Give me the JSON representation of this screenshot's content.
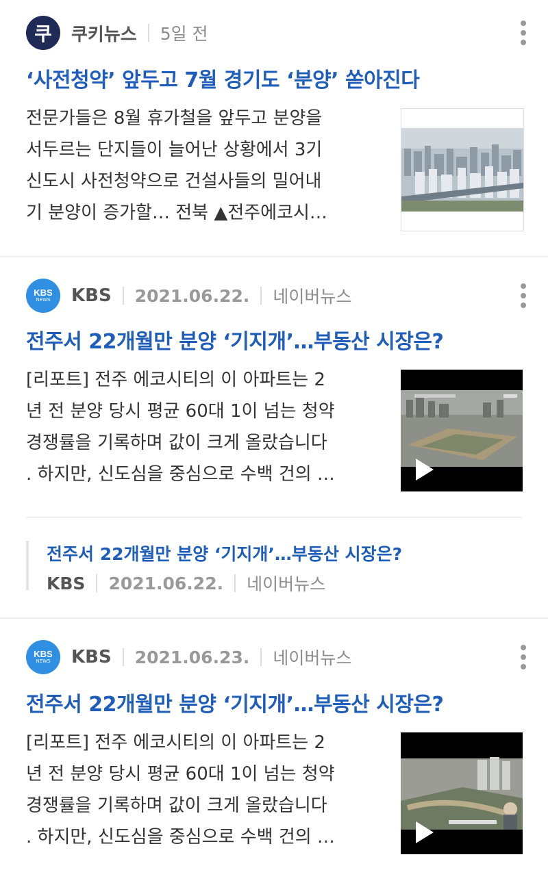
{
  "articles": [
    {
      "source": "쿠키뉴스",
      "time": "5일 전",
      "logo_char": "쿠",
      "headline": "‘사전청약’ 앞두고 7월 경기도 ‘분양’ 쏟아진다",
      "summary_lines": [
        "전문가들은 8월 휴가철을 앞두고 분양을",
        "서두르는 단지들이 늘어난 상황에서 3기",
        "신도시 사전청약으로 건설사들의 밀어내",
        "기 분양이 증가할… 전북 ▲전주에코시…"
      ],
      "thumbnail": "apartment-city-photo"
    },
    {
      "source": "KBS",
      "logo_line1": "KBS",
      "logo_line2": "NEWS",
      "date": "2021.06.22.",
      "portal": "네이버뉴스",
      "headline": "전주서 22개월만 분양 ‘기지개’…부동산 시장은?",
      "summary_lines": [
        "[리포트] 전주 에코시티의 이 아파트는 2",
        "년 전 분양 당시 평균 60대 1이 넘는 청약",
        "경쟁률을 기록하며 값이 크게 올랐습니다",
        ". 하지만, 신도심을 중심으로 수백 건의 …"
      ],
      "thumbnail": "video-thumbnail",
      "related": {
        "title": "전주서 22개월만 분양 ‘기지개’…부동산 시장은?",
        "source": "KBS",
        "date": "2021.06.22.",
        "portal": "네이버뉴스"
      }
    },
    {
      "source": "KBS",
      "logo_line1": "KBS",
      "logo_line2": "NEWS",
      "date": "2021.06.23.",
      "portal": "네이버뉴스",
      "headline": "전주서 22개월만 분양 ‘기지개’…부동산 시장은?",
      "summary_lines": [
        "[리포트] 전주 에코시티의 이 아파트는 2",
        "년 전 분양 당시 평균 60대 1이 넘는 청약",
        "경쟁률을 기록하며 값이 크게 올랐습니다",
        ". 하지만, 신도심을 중심으로 수백 건의 …"
      ],
      "thumbnail": "video-thumbnail"
    }
  ],
  "colors": {
    "headline": "#1f5dbb",
    "cookie_logo_bg": "#1f2b56",
    "kbs_logo_bg": "#2f8fe2"
  }
}
